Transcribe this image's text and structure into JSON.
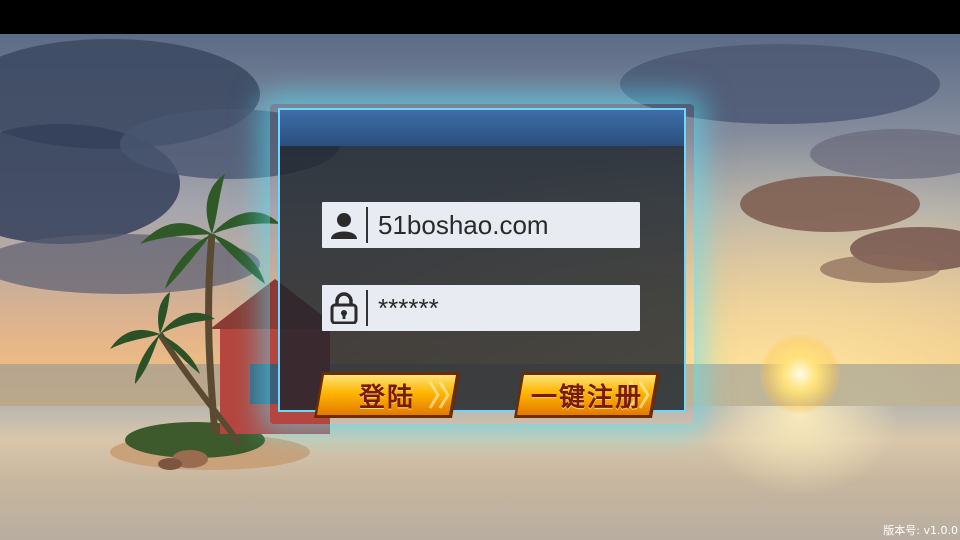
{
  "username_field": {
    "value": "51boshao.com",
    "icon": "user-icon"
  },
  "password_field": {
    "value": "******",
    "icon": "lock-icon"
  },
  "buttons": {
    "login_label": "登陆",
    "register_label": "一键注册"
  },
  "version_label": "版本号: v1.0.0",
  "colors": {
    "accent_glow": "#6fd6ff",
    "button_orange": "#ffb400",
    "panel_dark": "#1e242c"
  }
}
